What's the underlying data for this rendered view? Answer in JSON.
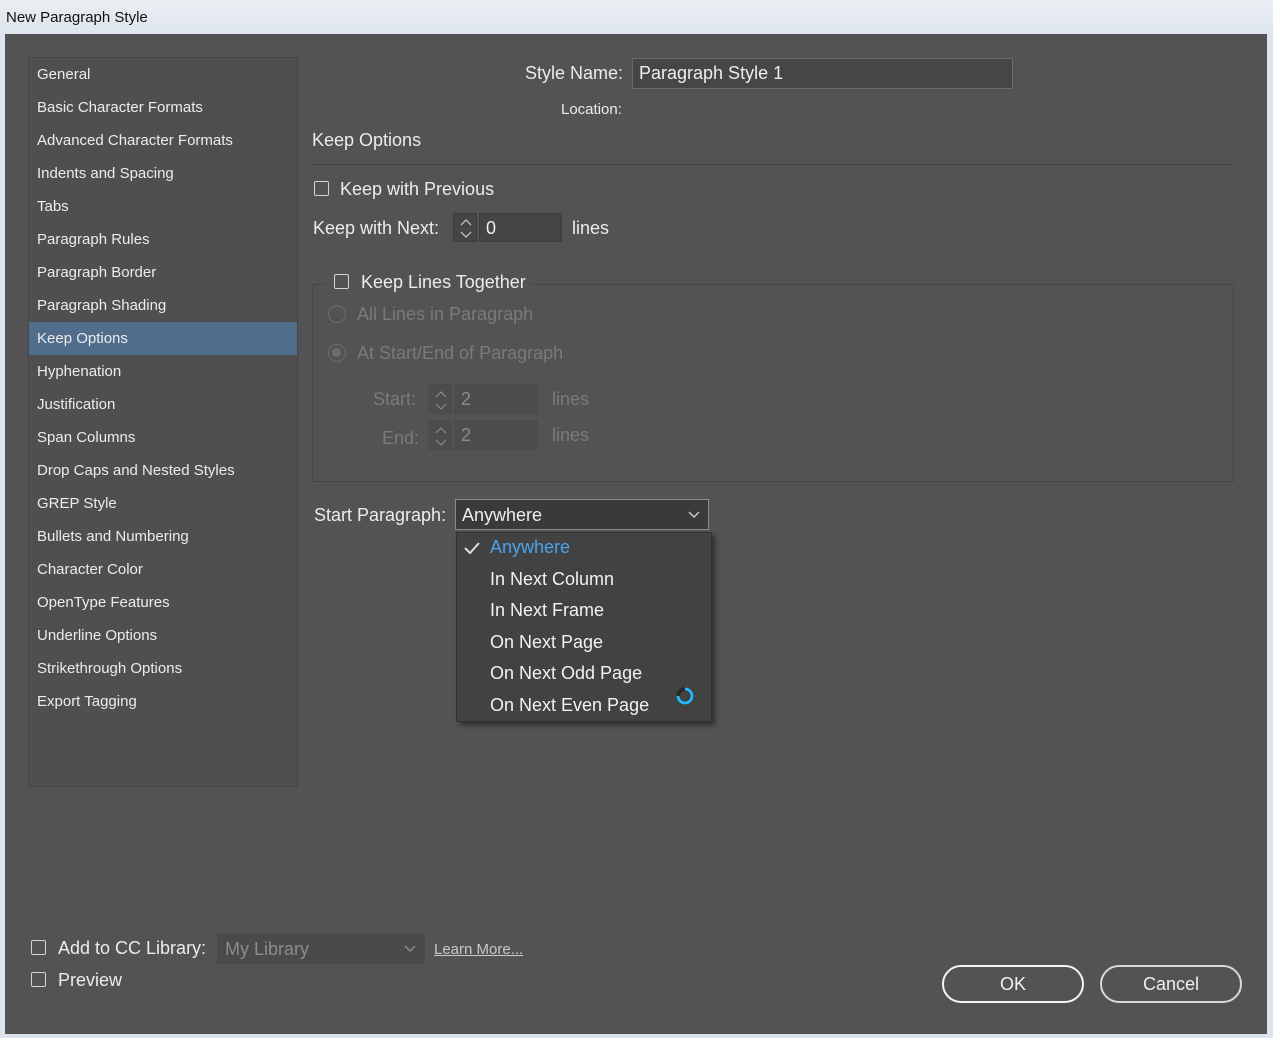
{
  "window": {
    "title": "New Paragraph Style"
  },
  "sidebar": {
    "items": [
      {
        "label": "General"
      },
      {
        "label": "Basic Character Formats"
      },
      {
        "label": "Advanced Character Formats"
      },
      {
        "label": "Indents and Spacing"
      },
      {
        "label": "Tabs"
      },
      {
        "label": "Paragraph Rules"
      },
      {
        "label": "Paragraph Border"
      },
      {
        "label": "Paragraph Shading"
      },
      {
        "label": "Keep Options"
      },
      {
        "label": "Hyphenation"
      },
      {
        "label": "Justification"
      },
      {
        "label": "Span Columns"
      },
      {
        "label": "Drop Caps and Nested Styles"
      },
      {
        "label": "GREP Style"
      },
      {
        "label": "Bullets and Numbering"
      },
      {
        "label": "Character Color"
      },
      {
        "label": "OpenType Features"
      },
      {
        "label": "Underline Options"
      },
      {
        "label": "Strikethrough Options"
      },
      {
        "label": "Export Tagging"
      }
    ],
    "selected": "Keep Options"
  },
  "style_name": {
    "label": "Style Name:",
    "value": "Paragraph Style 1"
  },
  "location": {
    "label": "Location:"
  },
  "section": {
    "title": "Keep Options"
  },
  "keep_with_previous": {
    "label": "Keep with Previous",
    "checked": false
  },
  "keep_with_next": {
    "label": "Keep with Next:",
    "value": "0",
    "unit": "lines"
  },
  "keep_lines_together": {
    "label": "Keep Lines Together",
    "checked": false,
    "all_lines_label": "All Lines in Paragraph",
    "start_end_label": "At Start/End of Paragraph",
    "start": {
      "label": "Start:",
      "value": "2",
      "unit": "lines"
    },
    "end": {
      "label": "End:",
      "value": "2",
      "unit": "lines"
    }
  },
  "start_paragraph": {
    "label": "Start Paragraph:",
    "value": "Anywhere",
    "options": [
      {
        "label": "Anywhere"
      },
      {
        "label": "In Next Column"
      },
      {
        "label": "In Next Frame"
      },
      {
        "label": "On Next Page"
      },
      {
        "label": "On Next Odd Page"
      },
      {
        "label": "On Next Even Page"
      }
    ]
  },
  "footer": {
    "add_to_cc_label": "Add to CC Library:",
    "library_value": "My Library",
    "learn_more": "Learn More...",
    "preview_label": "Preview",
    "ok_label": "OK",
    "cancel_label": "Cancel"
  },
  "colors": {
    "dialog_bg": "#535353",
    "selected_bg": "#506d8c",
    "menu_selected_text": "#4aa3ef",
    "spinner": "#29b6f6"
  }
}
